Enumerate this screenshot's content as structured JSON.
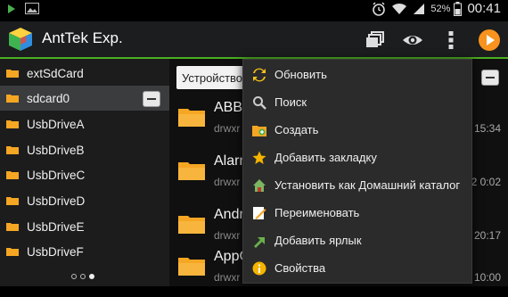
{
  "statusbar": {
    "battery_pct": "52%",
    "time": "00:41"
  },
  "app": {
    "title": "AntTek Exp."
  },
  "actionbar": {
    "icons": [
      "windows-icon",
      "eye-icon",
      "overflow-menu-icon",
      "play-icon"
    ]
  },
  "sidebar": {
    "items": [
      {
        "label": "extSdCard",
        "selected": false
      },
      {
        "label": "sdcard0",
        "selected": true
      },
      {
        "label": "UsbDriveA",
        "selected": false
      },
      {
        "label": "UsbDriveB",
        "selected": false
      },
      {
        "label": "UsbDriveC",
        "selected": false
      },
      {
        "label": "UsbDriveD",
        "selected": false
      },
      {
        "label": "UsbDriveE",
        "selected": false
      },
      {
        "label": "UsbDriveF",
        "selected": false
      }
    ],
    "pager": {
      "count": 3,
      "active": 3
    }
  },
  "main": {
    "path_label": "Устройство",
    "files": [
      {
        "name": "ABBY",
        "meta": "drwxr",
        "time": "15:34"
      },
      {
        "name": "Alarm",
        "meta": "drwxr",
        "time": "2 0:02"
      },
      {
        "name": "Andr",
        "meta": "drwxr",
        "time": "20:17"
      },
      {
        "name": "AppG",
        "meta": "drwxr",
        "time": "10:00"
      }
    ]
  },
  "menu": {
    "items": [
      {
        "label": "Обновить",
        "icon": "refresh-icon"
      },
      {
        "label": "Поиск",
        "icon": "search-icon"
      },
      {
        "label": "Создать",
        "icon": "new-folder-icon"
      },
      {
        "label": "Добавить закладку",
        "icon": "star-icon"
      },
      {
        "label": "Установить как Домашний каталог",
        "icon": "home-icon"
      },
      {
        "label": "Переименовать",
        "icon": "rename-icon"
      },
      {
        "label": "Добавить ярлык",
        "icon": "shortcut-icon"
      },
      {
        "label": "Свойства",
        "icon": "info-icon"
      }
    ]
  },
  "colors": {
    "accent": "#4caf1f",
    "folder": "#f5a623",
    "play": "#f7931e"
  }
}
